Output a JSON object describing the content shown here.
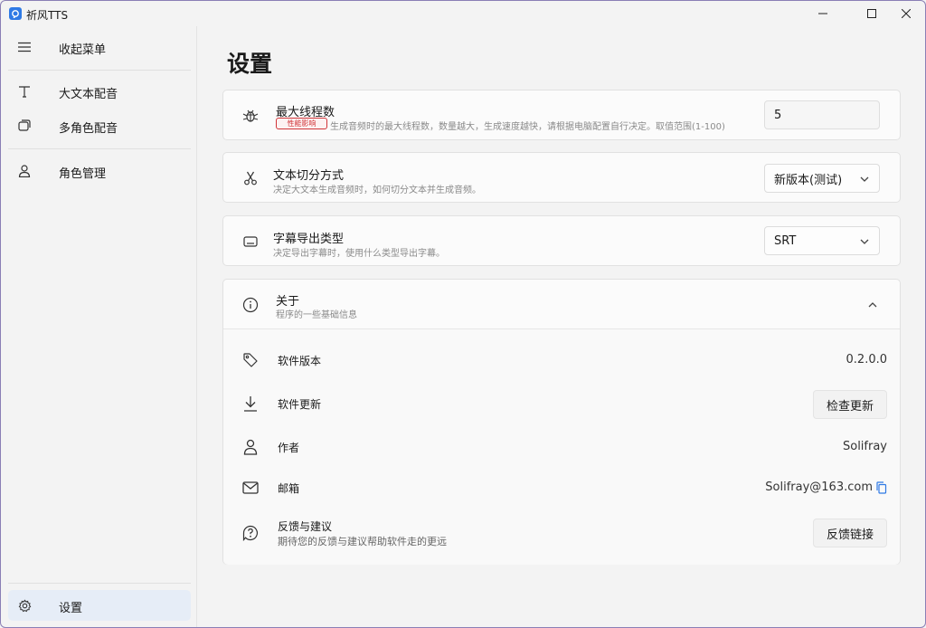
{
  "app": {
    "title": "祈风TTS"
  },
  "sidebar": {
    "collapse_label": "收起菜单",
    "items": [
      {
        "label": "大文本配音",
        "icon": "text-icon"
      },
      {
        "label": "多角色配音",
        "icon": "chat-icon"
      },
      {
        "label": "角色管理",
        "icon": "person-icon"
      }
    ],
    "settings_label": "设置"
  },
  "page": {
    "title": "设置"
  },
  "settings": {
    "threads": {
      "title": "最大线程数",
      "badge": "性能影响",
      "desc": "生成音频时的最大线程数，数量越大，生成速度越快，请根据电脑配置自行决定。取值范围(1-100)",
      "value": "5"
    },
    "split": {
      "title": "文本切分方式",
      "desc": "决定大文本生成音频时，如何切分文本并生成音频。",
      "value": "新版本(测试)"
    },
    "subtitle": {
      "title": "字幕导出类型",
      "desc": "决定导出字幕时，使用什么类型导出字幕。",
      "value": "SRT"
    }
  },
  "about": {
    "title": "关于",
    "desc": "程序的一些基础信息",
    "version_label": "软件版本",
    "version_value": "0.2.0.0",
    "update_label": "软件更新",
    "update_button": "检查更新",
    "author_label": "作者",
    "author_value": "Solifray",
    "email_label": "邮箱",
    "email_value": "Solifray@163.com",
    "feedback_label": "反馈与建议",
    "feedback_desc": "期待您的反馈与建议帮助软件走的更远",
    "feedback_button": "反馈链接"
  },
  "colors": {
    "accent": "#2f7ae5",
    "danger": "#d13438"
  }
}
